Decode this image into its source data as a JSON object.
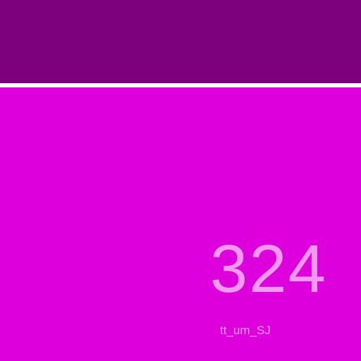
{
  "theme": {
    "top_bar_color": "#7d007d",
    "divider_color": "#ffffff",
    "panel_color": "#dd00dd",
    "text_color": "#f29af2"
  },
  "main": {
    "value": "324",
    "caption": "tt_um_SJ"
  }
}
